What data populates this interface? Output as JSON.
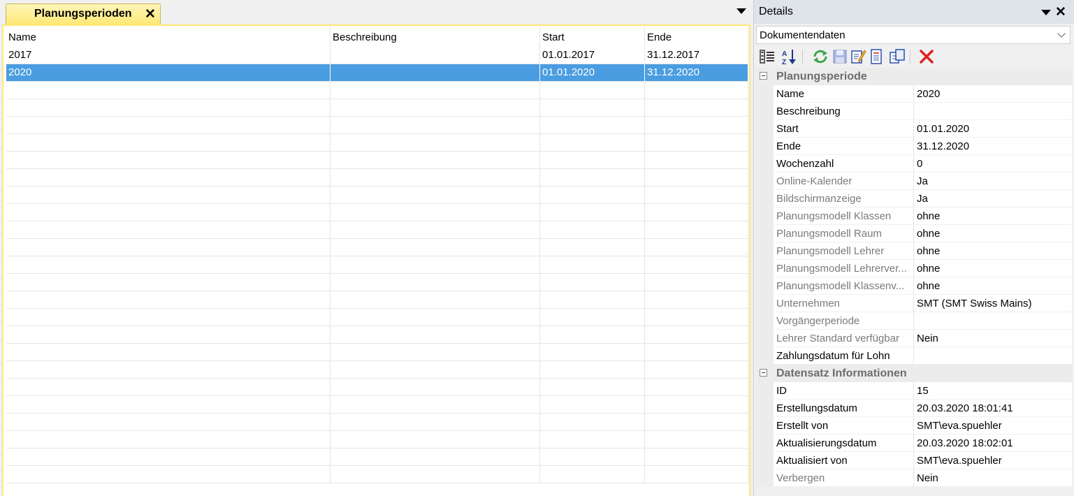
{
  "left_tab": {
    "title": "Planungsperioden",
    "close_icon": "close-icon",
    "menu_icon": "dropdown-triangle-icon"
  },
  "grid": {
    "columns": [
      "Name",
      "Beschreibung",
      "Start",
      "Ende"
    ],
    "rows": [
      {
        "name": "2017",
        "beschreibung": "",
        "start": "01.01.2017",
        "ende": "31.12.2017",
        "selected": false
      },
      {
        "name": "2020",
        "beschreibung": "",
        "start": "01.01.2020",
        "ende": "31.12.2020",
        "selected": true
      }
    ],
    "empty_rows": 23,
    "selected_color": "#4a9de0"
  },
  "details": {
    "title": "Details",
    "combo_value": "Dokumentendaten",
    "toolbar_icons": [
      "categorized-view-icon",
      "sort-az-icon",
      "refresh-icon",
      "save-icon",
      "edit-icon",
      "document-icon",
      "copy-icon",
      "delete-icon"
    ],
    "categories": [
      {
        "label": "Planungsperiode",
        "rows": [
          {
            "name": "Name",
            "value": "2020",
            "readonly": false
          },
          {
            "name": "Beschreibung",
            "value": "",
            "readonly": false
          },
          {
            "name": "Start",
            "value": "01.01.2020",
            "readonly": false
          },
          {
            "name": "Ende",
            "value": "31.12.2020",
            "readonly": false
          },
          {
            "name": "Wochenzahl",
            "value": "0",
            "readonly": false
          },
          {
            "name": "Online-Kalender",
            "value": "Ja",
            "readonly": true
          },
          {
            "name": "Bildschirmanzeige",
            "value": "Ja",
            "readonly": true
          },
          {
            "name": "Planungsmodell Klassen",
            "value": "ohne",
            "readonly": true
          },
          {
            "name": "Planungsmodell Raum",
            "value": "ohne",
            "readonly": true
          },
          {
            "name": "Planungsmodell Lehrer",
            "value": "ohne",
            "readonly": true
          },
          {
            "name": "Planungsmodell Lehrerver...",
            "value": "ohne",
            "readonly": true
          },
          {
            "name": "Planungsmodell Klassenv...",
            "value": "ohne",
            "readonly": true
          },
          {
            "name": "Unternehmen",
            "value": "SMT (SMT Swiss Mains)",
            "readonly": true
          },
          {
            "name": "Vorgängerperiode",
            "value": "",
            "readonly": true
          },
          {
            "name": "Lehrer Standard verfügbar",
            "value": "Nein",
            "readonly": true
          },
          {
            "name": "Zahlungsdatum für Lohn",
            "value": "",
            "readonly": false
          }
        ]
      },
      {
        "label": "Datensatz Informationen",
        "rows": [
          {
            "name": "ID",
            "value": "15",
            "readonly": false
          },
          {
            "name": "Erstellungsdatum",
            "value": "20.03.2020 18:01:41",
            "readonly": false
          },
          {
            "name": "Erstellt von",
            "value": "SMT\\eva.spuehler",
            "readonly": false
          },
          {
            "name": "Aktualisierungsdatum",
            "value": "20.03.2020 18:02:01",
            "readonly": false
          },
          {
            "name": "Aktualisiert von",
            "value": "SMT\\eva.spuehler",
            "readonly": false
          },
          {
            "name": "Verbergen",
            "value": "Nein",
            "readonly": true
          }
        ]
      }
    ]
  }
}
